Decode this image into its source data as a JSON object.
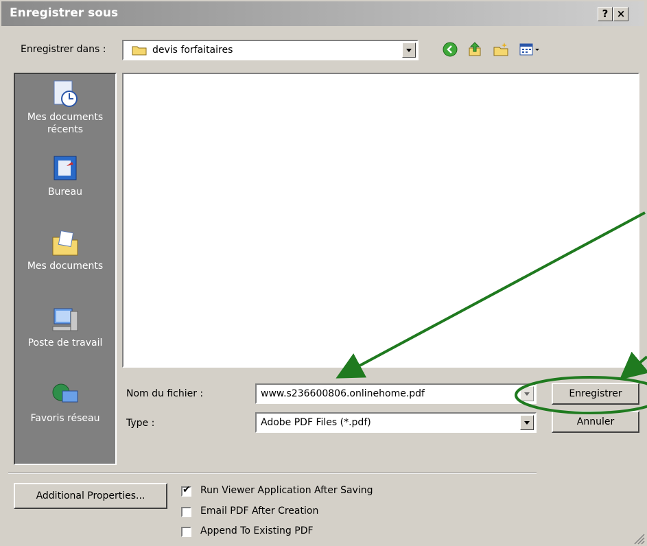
{
  "window": {
    "title": "Enregistrer sous",
    "help_label": "?",
    "close_label": "×"
  },
  "location": {
    "label": "Enregistrer dans :",
    "folder": "devis forfaitaires"
  },
  "toolbar": {
    "icons": [
      "back-icon",
      "up-folder-icon",
      "new-folder-icon",
      "view-menu-icon"
    ]
  },
  "places": [
    {
      "label": "Mes documents\nrécents",
      "icon": "recent-documents-icon"
    },
    {
      "label": "Bureau",
      "icon": "desktop-icon"
    },
    {
      "label": "Mes documents",
      "icon": "my-documents-icon"
    },
    {
      "label": "Poste de travail",
      "icon": "my-computer-icon"
    },
    {
      "label": "Favoris réseau",
      "icon": "network-places-icon"
    }
  ],
  "filename": {
    "label": "Nom du fichier :",
    "value": "www.s236600806.onlinehome.pdf"
  },
  "filetype": {
    "label": "Type :",
    "value": "Adobe PDF Files (*.pdf)"
  },
  "buttons": {
    "save": "Enregistrer",
    "cancel": "Annuler",
    "additional": "Additional Properties..."
  },
  "options": [
    {
      "label": "Run Viewer Application After Saving",
      "checked": true
    },
    {
      "label": "Email PDF After Creation",
      "checked": false
    },
    {
      "label": "Append To Existing PDF",
      "checked": false
    }
  ],
  "annotation_color": "#1f7a1f"
}
